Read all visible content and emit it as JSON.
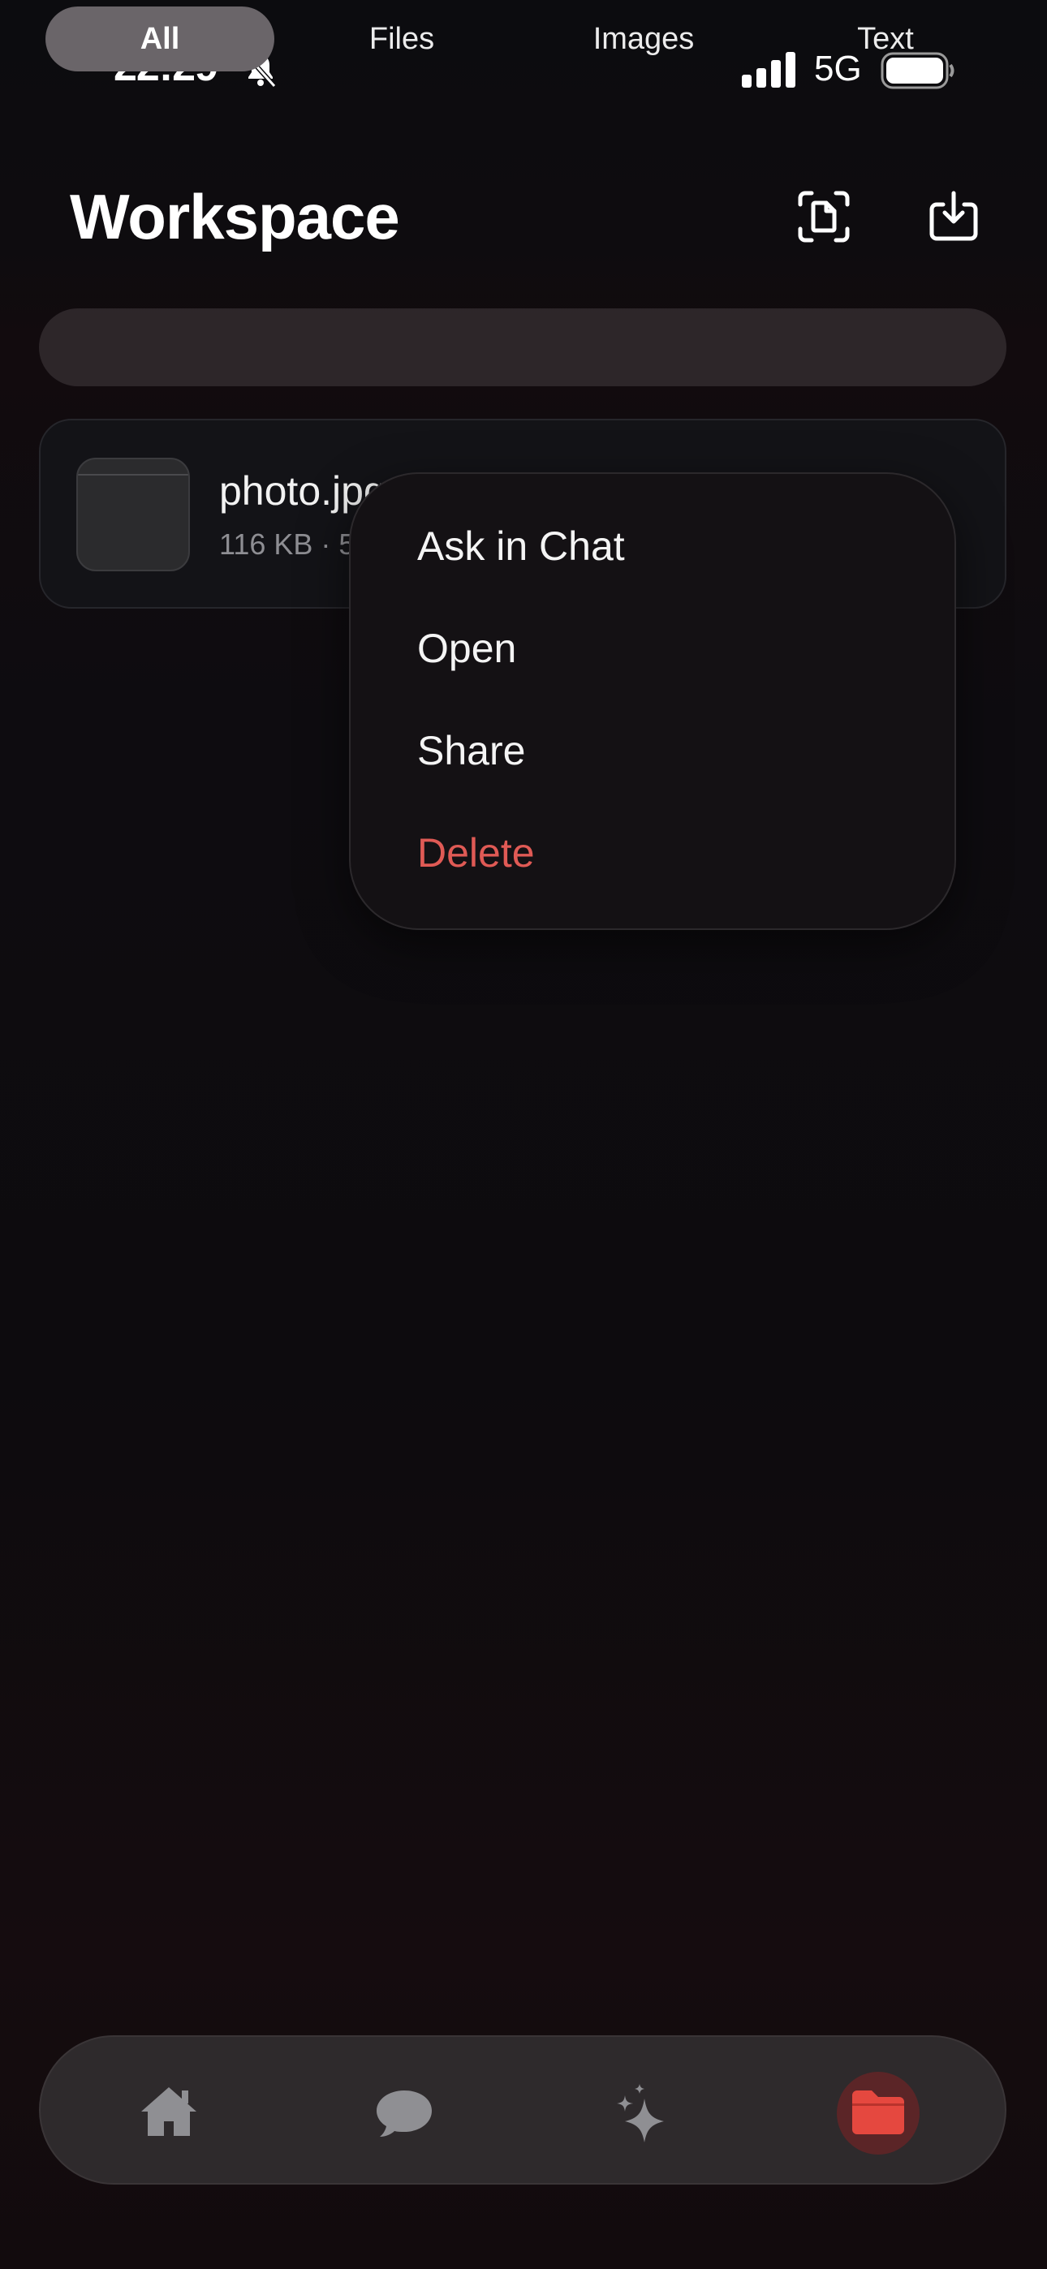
{
  "status_bar": {
    "time": "22:29",
    "network": "5G",
    "icons": [
      "bell-slash-icon",
      "cellular-signal-icon",
      "battery-icon"
    ]
  },
  "header": {
    "title": "Workspace",
    "actions": [
      {
        "icon": "document-scan-icon"
      },
      {
        "icon": "download-tray-icon"
      }
    ]
  },
  "filter_tabs": {
    "items": [
      {
        "label": "All",
        "selected": true
      },
      {
        "label": "Files",
        "selected": false
      },
      {
        "label": "Images",
        "selected": false
      },
      {
        "label": "Text",
        "selected": false
      }
    ]
  },
  "files": [
    {
      "name": "photo.jpg",
      "visible_name": "photo.jpg",
      "meta": "116 KB · 5",
      "thumbnail_icon": "image-thumbnail"
    }
  ],
  "context_menu": {
    "items": [
      {
        "label": "Ask in Chat",
        "destructive": false
      },
      {
        "label": "Open",
        "destructive": false
      },
      {
        "label": "Share",
        "destructive": false
      },
      {
        "label": "Delete",
        "destructive": true
      }
    ]
  },
  "tab_bar": {
    "items": [
      {
        "icon": "home-icon",
        "selected": false
      },
      {
        "icon": "chat-bubble-icon",
        "selected": false
      },
      {
        "icon": "sparkles-icon",
        "selected": false
      },
      {
        "icon": "folder-icon",
        "selected": true
      }
    ]
  },
  "colors": {
    "accent": "#e5483f",
    "destructive": "#e05a55",
    "background": "#0d0b0e"
  }
}
